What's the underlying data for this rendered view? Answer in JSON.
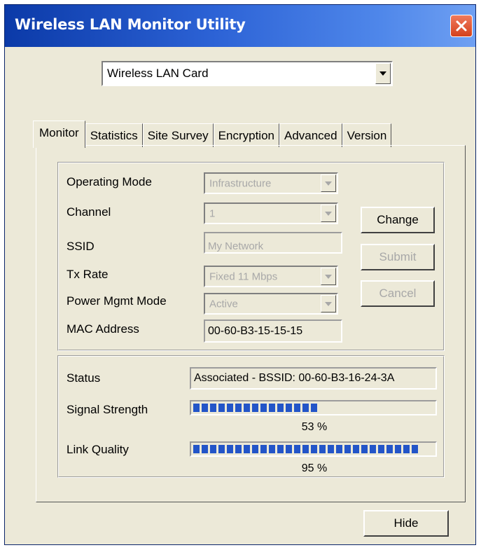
{
  "window": {
    "title": "Wireless LAN Monitor Utility"
  },
  "adapter": {
    "selected": "Wireless LAN Card"
  },
  "tabs": [
    "Monitor",
    "Statistics",
    "Site Survey",
    "Encryption",
    "Advanced",
    "Version"
  ],
  "active_tab": "Monitor",
  "config": {
    "operating_mode": {
      "label": "Operating Mode",
      "value": "Infrastructure"
    },
    "channel": {
      "label": "Channel",
      "value": "1"
    },
    "ssid": {
      "label": "SSID",
      "value": "My Network"
    },
    "tx_rate": {
      "label": "Tx Rate",
      "value": "Fixed 11 Mbps"
    },
    "power_mgmt": {
      "label": "Power Mgmt Mode",
      "value": "Active"
    },
    "mac": {
      "label": "MAC Address",
      "value": "00-60-B3-15-15-15"
    }
  },
  "buttons": {
    "change": "Change",
    "submit": "Submit",
    "cancel": "Cancel",
    "hide": "Hide"
  },
  "status": {
    "status_label": "Status",
    "status_value": "Associated - BSSID: 00-60-B3-16-24-3A",
    "signal_label": "Signal Strength",
    "signal_percent": 53,
    "signal_text": "53 %",
    "link_label": "Link Quality",
    "link_percent": 95,
    "link_text": "95 %"
  },
  "colors": {
    "title_bar": "#2d63d6",
    "meter_fill": "#2355c8",
    "close_button": "#d4411b"
  },
  "icons": {
    "close": "close-icon",
    "dropdown": "chevron-down-icon"
  }
}
